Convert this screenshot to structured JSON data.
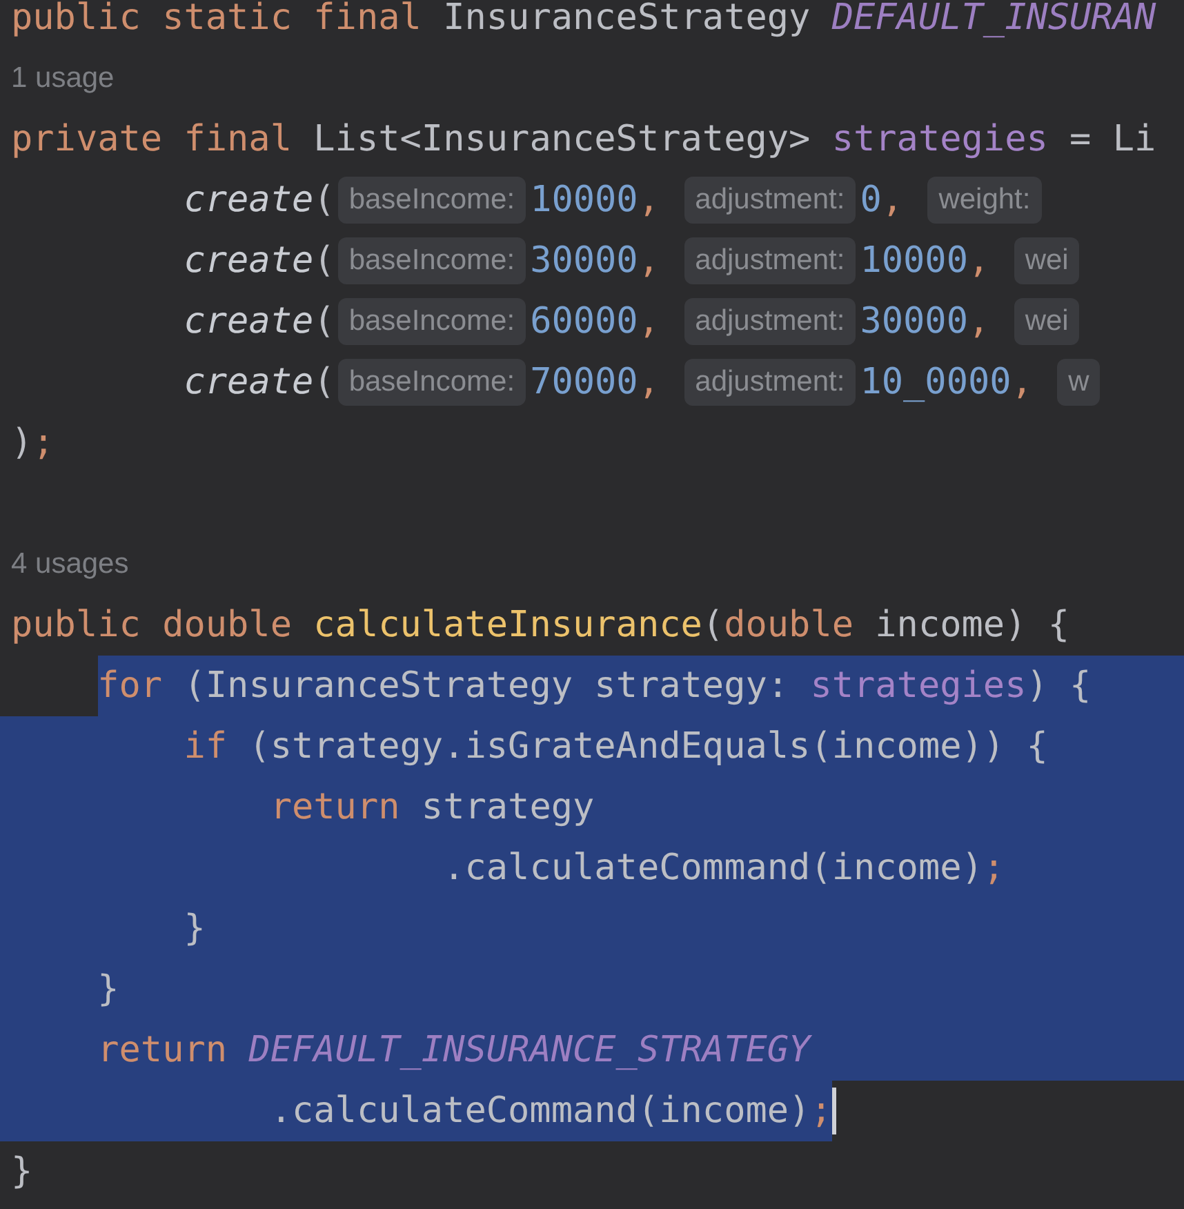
{
  "editor": {
    "lines": [
      {
        "kind": "code",
        "selected": false,
        "tokens": [
          {
            "kind": "keyword",
            "text": "public static final"
          },
          {
            "kind": "plain",
            "text": " InsuranceStrategy "
          },
          {
            "kind": "constant",
            "text": "DEFAULT_INSURAN"
          }
        ]
      },
      {
        "kind": "usage",
        "text": "1 usage"
      },
      {
        "kind": "code",
        "selected": false,
        "tokens": [
          {
            "kind": "keyword",
            "text": "private final"
          },
          {
            "kind": "plain",
            "text": " List<InsuranceStrategy> "
          },
          {
            "kind": "field",
            "text": "strategies"
          },
          {
            "kind": "plain",
            "text": " = Li"
          }
        ]
      },
      {
        "kind": "code",
        "selected": false,
        "tokens": [
          {
            "kind": "call",
            "text": "        create"
          },
          {
            "kind": "plain",
            "text": "("
          },
          {
            "kind": "hint",
            "text": "baseIncome:"
          },
          {
            "kind": "number",
            "text": "10000"
          },
          {
            "kind": "punct",
            "text": ", "
          },
          {
            "kind": "hint",
            "text": "adjustment:"
          },
          {
            "kind": "number",
            "text": "0"
          },
          {
            "kind": "punct",
            "text": ", "
          },
          {
            "kind": "hint",
            "text": "weight:"
          }
        ]
      },
      {
        "kind": "code",
        "selected": false,
        "tokens": [
          {
            "kind": "call",
            "text": "        create"
          },
          {
            "kind": "plain",
            "text": "("
          },
          {
            "kind": "hint",
            "text": "baseIncome:"
          },
          {
            "kind": "number",
            "text": "30000"
          },
          {
            "kind": "punct",
            "text": ", "
          },
          {
            "kind": "hint",
            "text": "adjustment:"
          },
          {
            "kind": "number",
            "text": "10000"
          },
          {
            "kind": "punct",
            "text": ", "
          },
          {
            "kind": "hint",
            "text": "wei"
          }
        ]
      },
      {
        "kind": "code",
        "selected": false,
        "tokens": [
          {
            "kind": "call",
            "text": "        create"
          },
          {
            "kind": "plain",
            "text": "("
          },
          {
            "kind": "hint",
            "text": "baseIncome:"
          },
          {
            "kind": "number",
            "text": "60000"
          },
          {
            "kind": "punct",
            "text": ", "
          },
          {
            "kind": "hint",
            "text": "adjustment:"
          },
          {
            "kind": "number",
            "text": "30000"
          },
          {
            "kind": "punct",
            "text": ", "
          },
          {
            "kind": "hint",
            "text": "wei"
          }
        ]
      },
      {
        "kind": "code",
        "selected": false,
        "tokens": [
          {
            "kind": "call",
            "text": "        create"
          },
          {
            "kind": "plain",
            "text": "("
          },
          {
            "kind": "hint",
            "text": "baseIncome:"
          },
          {
            "kind": "number",
            "text": "70000"
          },
          {
            "kind": "punct",
            "text": ", "
          },
          {
            "kind": "hint",
            "text": "adjustment:"
          },
          {
            "kind": "number",
            "text": "10_0000"
          },
          {
            "kind": "punct",
            "text": ", "
          },
          {
            "kind": "hint",
            "text": "w"
          }
        ]
      },
      {
        "kind": "code",
        "selected": false,
        "tokens": [
          {
            "kind": "plain",
            "text": ")"
          },
          {
            "kind": "punct",
            "text": ";"
          }
        ]
      },
      {
        "kind": "blank"
      },
      {
        "kind": "usage",
        "text": "4 usages"
      },
      {
        "kind": "code",
        "selected": false,
        "tokens": [
          {
            "kind": "keyword",
            "text": "public double "
          },
          {
            "kind": "method",
            "text": "calculateInsurance"
          },
          {
            "kind": "plain",
            "text": "("
          },
          {
            "kind": "keyword",
            "text": "double"
          },
          {
            "kind": "plain",
            "text": " income) {"
          }
        ]
      },
      {
        "kind": "code",
        "selected": true,
        "tokens": [
          {
            "kind": "keyword",
            "text": "    for"
          },
          {
            "kind": "plain",
            "text": " (InsuranceStrategy strategy: "
          },
          {
            "kind": "field",
            "text": "strategies"
          },
          {
            "kind": "plain",
            "text": ") {"
          }
        ]
      },
      {
        "kind": "code",
        "selected": true,
        "tokens": [
          {
            "kind": "keyword",
            "text": "        if"
          },
          {
            "kind": "plain",
            "text": " (strategy.isGrateAndEquals(income)) {"
          }
        ]
      },
      {
        "kind": "code",
        "selected": true,
        "tokens": [
          {
            "kind": "keyword",
            "text": "            return"
          },
          {
            "kind": "plain",
            "text": " strategy"
          }
        ]
      },
      {
        "kind": "code",
        "selected": true,
        "tokens": [
          {
            "kind": "plain",
            "text": "                    .calculateCommand(income)"
          },
          {
            "kind": "punct",
            "text": ";"
          }
        ]
      },
      {
        "kind": "code",
        "selected": true,
        "tokens": [
          {
            "kind": "plain",
            "text": "        }"
          }
        ]
      },
      {
        "kind": "code",
        "selected": true,
        "tokens": [
          {
            "kind": "plain",
            "text": "    }"
          }
        ]
      },
      {
        "kind": "code",
        "selected": true,
        "tokens": [
          {
            "kind": "keyword",
            "text": "    return "
          },
          {
            "kind": "constant",
            "text": "DEFAULT_INSURANCE_STRATEGY"
          }
        ]
      },
      {
        "kind": "code",
        "selected": true,
        "caret": true,
        "tokens": [
          {
            "kind": "plain",
            "text": "            .calculateCommand(income)"
          },
          {
            "kind": "punct",
            "text": ";"
          }
        ]
      },
      {
        "kind": "code",
        "selected": false,
        "tokens": [
          {
            "kind": "plain",
            "text": "}"
          }
        ]
      }
    ]
  }
}
